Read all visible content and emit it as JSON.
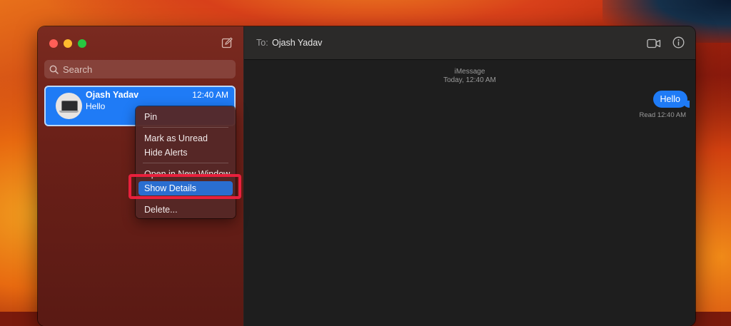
{
  "sidebar": {
    "search_placeholder": "Search",
    "conversation": {
      "name": "Ojash Yadav",
      "time": "12:40 AM",
      "preview": "Hello"
    }
  },
  "context_menu": {
    "items": [
      "Pin",
      "Mark as Unread",
      "Hide Alerts",
      "Open in New Window",
      "Show Details",
      "Delete..."
    ],
    "highlighted": "Show Details"
  },
  "header": {
    "to_label": "To:",
    "recipient": "Ojash Yadav"
  },
  "messages": {
    "service": "iMessage",
    "date": "Today, 12:40 AM",
    "bubble": "Hello",
    "status": "Read 12:40 AM"
  },
  "colors": {
    "accent": "#1f7bf6",
    "annotation": "#e8203c"
  }
}
